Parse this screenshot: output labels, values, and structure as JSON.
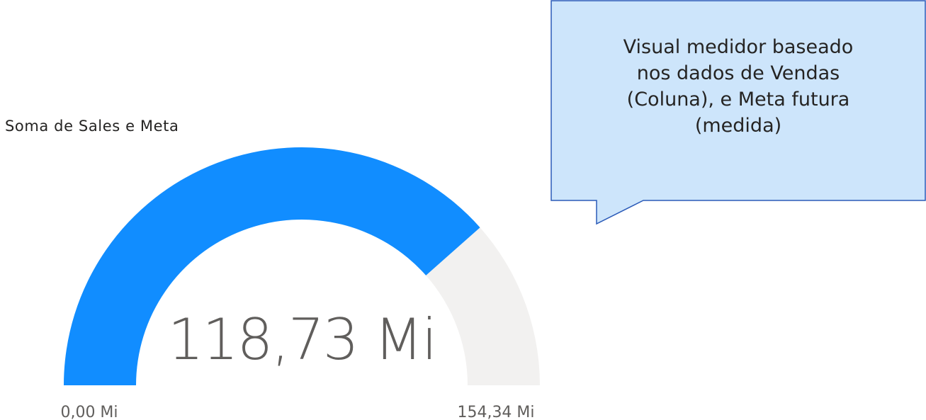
{
  "visual": {
    "title": "Soma de Sales e Meta"
  },
  "callout": {
    "text_lines": [
      "Visual medidor baseado",
      "nos dados de Vendas",
      "(Coluna), e Meta futura",
      "(medida)"
    ]
  },
  "colors": {
    "value_fill": "#118DFF",
    "remainder_fill": "#F2F1F0",
    "callout_fill": "#CDE5FB",
    "callout_stroke": "#2B5BB8",
    "label_text": "#605E5C",
    "value_text": "#605E5C"
  },
  "chart_data": {
    "type": "gauge",
    "title": "Soma de Sales e Meta",
    "value": 118.73,
    "min": 0,
    "max": 154.34,
    "unit": "Mi",
    "value_label": "118,73 Mi",
    "min_label": "0,00 Mi",
    "max_label": "154,34 Mi"
  }
}
